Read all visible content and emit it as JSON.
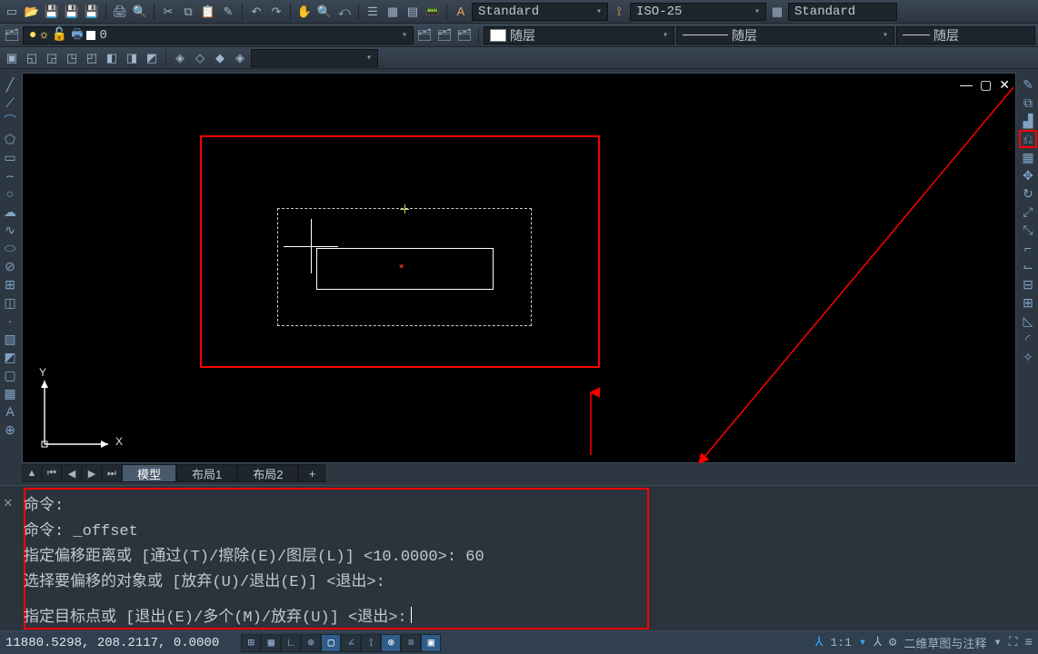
{
  "top_dropdowns": {
    "textstyle": "Standard",
    "dimstyle": "ISO-25",
    "tablestyle": "Standard"
  },
  "layer_row": {
    "layer_name": "0",
    "color_drop": "随层",
    "ltype_drop": "随层",
    "lweight_drop": "随层"
  },
  "tabs": {
    "model": "模型",
    "layout1": "布局1",
    "layout2": "布局2",
    "add": "+"
  },
  "ucs": {
    "x": "X",
    "y": "Y"
  },
  "command_lines": [
    "命令:",
    "命令: _offset",
    "指定偏移距离或 [通过(T)/擦除(E)/图层(L)] <10.0000>: 60",
    "选择要偏移的对象或 [放弃(U)/退出(E)] <退出>:"
  ],
  "command_prompt": "指定目标点或 [退出(E)/多个(M)/放弃(U)] <退出>: ",
  "status": {
    "coords": "11880.5298, 208.2117, 0.0000",
    "scale": "1:1",
    "ann_text": "二维草图与注释"
  }
}
